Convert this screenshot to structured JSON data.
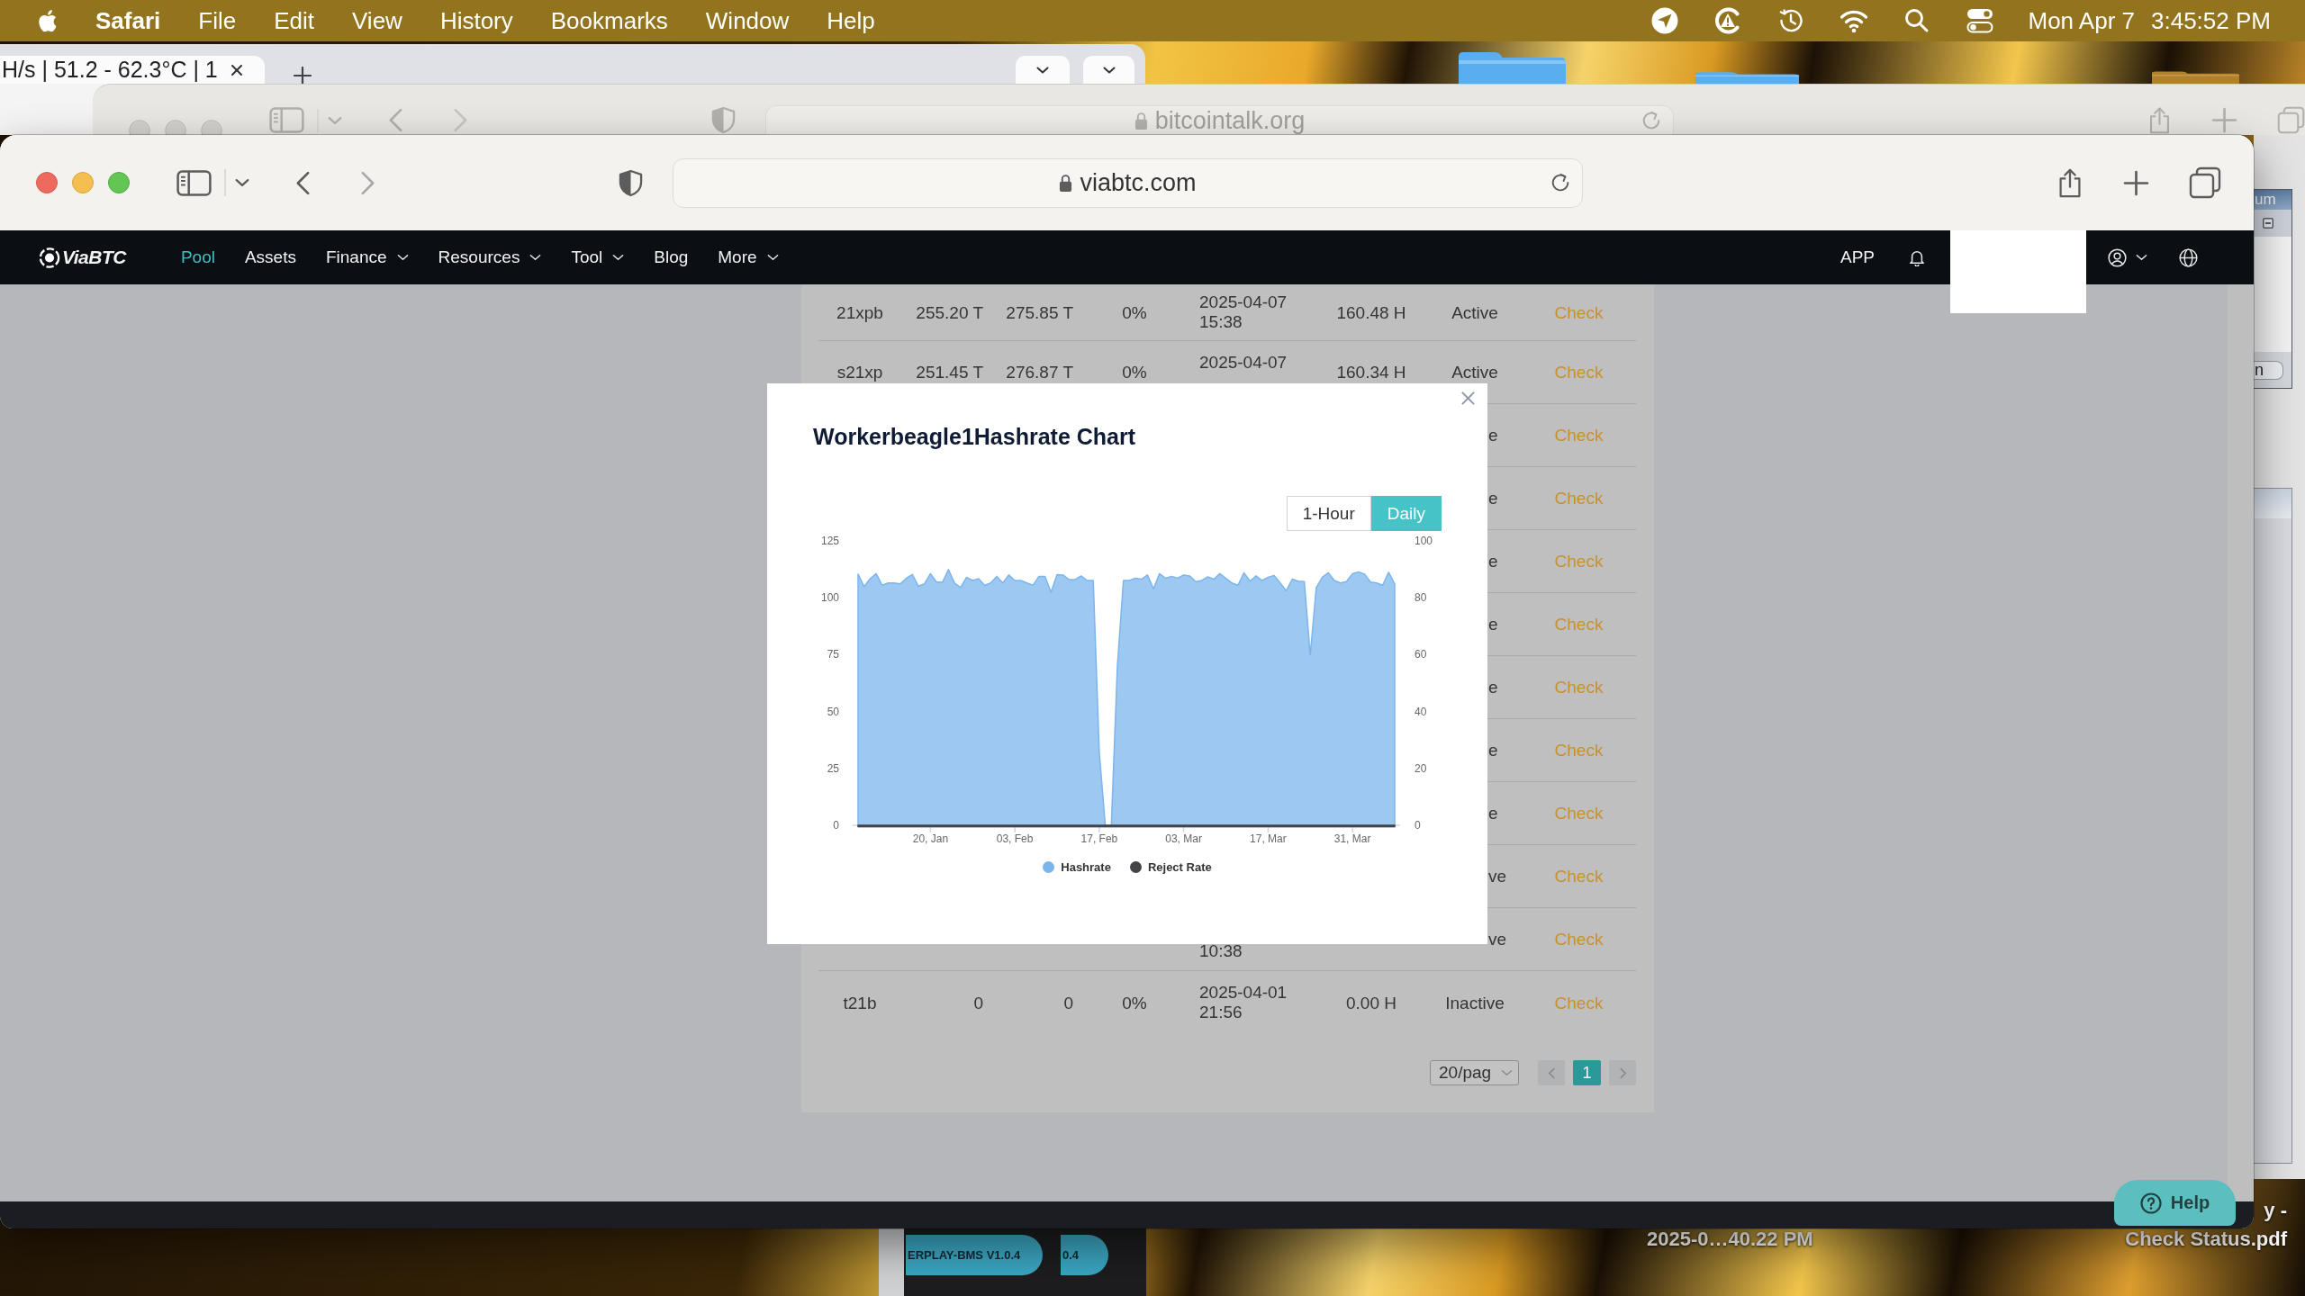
{
  "menu_bar": {
    "app_name": "Safari",
    "menus": [
      "File",
      "Edit",
      "View",
      "History",
      "Bookmarks",
      "Window",
      "Help"
    ],
    "date": "Mon Apr 7",
    "time": "3:45:52 PM"
  },
  "background_tab_window": {
    "tab_title": "H/s | 51.2 - 62.3°C | 1"
  },
  "background_window": {
    "address": "bitcointalk.org"
  },
  "side_window": {
    "header": "um",
    "button_label": "n"
  },
  "browser": {
    "address": "viabtc.com"
  },
  "site_nav": {
    "logo": "ViaBTC",
    "items": [
      {
        "label": "Pool",
        "selected": true,
        "dropdown": false
      },
      {
        "label": "Assets",
        "selected": false,
        "dropdown": false
      },
      {
        "label": "Finance",
        "selected": false,
        "dropdown": true
      },
      {
        "label": "Resources",
        "selected": false,
        "dropdown": true
      },
      {
        "label": "Tool",
        "selected": false,
        "dropdown": true
      },
      {
        "label": "Blog",
        "selected": false,
        "dropdown": false
      },
      {
        "label": "More",
        "selected": false,
        "dropdown": true
      }
    ],
    "app_link": "APP"
  },
  "workers_table": {
    "rows": [
      {
        "kind": "full",
        "column_1": "21xpb",
        "column_2": "255.20 T",
        "column_3": "275.85 T",
        "column_4": "0%",
        "column_5": {
          "line_1": "2025-04-07",
          "line_2": "15:38"
        },
        "column_6": "160.48 H",
        "column_7": "Active",
        "column_8": "Check"
      },
      {
        "kind": "full",
        "column_1": "s21xp",
        "column_2": "251.45 T",
        "column_3": "276.87 T",
        "column_4": "0%",
        "column_5": {
          "line_1": "2025-04-07"
        },
        "column_6": "160.34 H",
        "column_7": "Active",
        "column_8": "Check"
      },
      {
        "kind": "covered",
        "column_7": "e",
        "column_8": "Check"
      },
      {
        "kind": "covered",
        "column_7": "e",
        "column_8": "Check"
      },
      {
        "kind": "covered",
        "column_7": "e",
        "column_8": "Check"
      },
      {
        "kind": "covered",
        "column_7": "e",
        "column_8": "Check"
      },
      {
        "kind": "covered",
        "column_7": "e",
        "column_8": "Check"
      },
      {
        "kind": "covered",
        "column_7": "e",
        "column_8": "Check"
      },
      {
        "kind": "covered",
        "column_7": "e",
        "column_8": "Check"
      },
      {
        "kind": "covered",
        "column_7": "ve",
        "column_8": "Check"
      },
      {
        "kind": "covered",
        "column_5": {
          "line_2": "10:38"
        },
        "column_7": "ve",
        "column_8": "Check"
      },
      {
        "kind": "full",
        "column_1": "t21b",
        "column_2": "0",
        "column_3": "0",
        "column_4": "0%",
        "column_5": {
          "line_1": "2025-04-01",
          "line_2": "21:56"
        },
        "column_6": "0.00 H",
        "column_7": "Inactive",
        "column_8": "Check"
      }
    ],
    "pagination": {
      "page_size": "20/pag",
      "pages": [
        {
          "label": "1",
          "selected": true
        }
      ]
    }
  },
  "chart_modal": {
    "title": "Workerbeagle1Hashrate Chart",
    "ranges": [
      {
        "label": "1-Hour",
        "selected": false
      },
      {
        "label": "Daily",
        "selected": true
      }
    ],
    "chart_data": {
      "type": "area",
      "legend": "bottom",
      "categories": [
        null,
        null,
        null,
        null,
        null,
        null,
        null,
        null,
        null,
        null,
        null,
        null,
        "20, Jan",
        null,
        null,
        null,
        null,
        null,
        null,
        null,
        null,
        null,
        null,
        null,
        null,
        null,
        "03, Feb",
        null,
        null,
        null,
        null,
        null,
        null,
        null,
        null,
        null,
        null,
        null,
        null,
        null,
        "17, Feb",
        null,
        null,
        null,
        null,
        null,
        null,
        null,
        null,
        null,
        null,
        null,
        null,
        null,
        "03, Mar",
        null,
        null,
        null,
        null,
        null,
        null,
        null,
        null,
        null,
        null,
        null,
        null,
        null,
        "17, Mar",
        null,
        null,
        null,
        null,
        null,
        null,
        null,
        null,
        null,
        null,
        null,
        null,
        null,
        "31, Mar",
        null,
        null,
        null,
        null,
        null,
        null,
        null
      ],
      "series": [
        {
          "name": "Hashrate",
          "color": "#7cb5ec",
          "values": [
            110.4,
            104.9,
            108.4,
            110.6,
            105.5,
            106.5,
            106.5,
            106.1,
            108.6,
            110.2,
            105.1,
            106.1,
            110.6,
            106.9,
            106.9,
            112.4,
            106.5,
            104.5,
            109.0,
            107.6,
            108.4,
            105.5,
            106.5,
            109.4,
            106.5,
            110.0,
            107.6,
            107.6,
            106.5,
            105.5,
            109.4,
            109.4,
            102.4,
            110.2,
            110.0,
            108.0,
            108.0,
            109.6,
            107.6,
            107.6,
            32,
            0,
            0,
            70,
            107.6,
            107.6,
            108.6,
            108.2,
            110.0,
            103.9,
            110.6,
            108.6,
            109.4,
            108.6,
            110.0,
            109.6,
            107.1,
            107.6,
            109.2,
            108.2,
            110.6,
            108.6,
            106.5,
            105.5,
            111.0,
            107.3,
            109.6,
            107.6,
            109.0,
            109.8,
            106.5,
            103.1,
            108.2,
            107.3,
            107.1,
            74.9,
            104.5,
            109.0,
            111.0,
            107.6,
            106.5,
            107.1,
            110.6,
            111.4,
            110.4,
            106.9,
            106.5,
            105.5,
            111.2,
            106.1
          ]
        },
        {
          "name": "Reject Rate",
          "color": "#434348",
          "values": [
            0,
            0,
            0,
            0,
            0,
            0,
            0,
            0,
            0,
            0,
            0,
            0,
            0,
            0,
            0,
            0,
            0,
            0,
            0,
            0,
            0,
            0,
            0,
            0,
            0,
            0,
            0,
            0,
            0,
            0,
            0,
            0,
            0,
            0,
            0,
            0,
            0,
            0,
            0,
            0,
            0,
            0,
            0,
            0,
            0,
            0,
            0,
            0,
            0,
            0,
            0,
            0,
            0,
            0,
            0,
            0,
            0,
            0,
            0,
            0,
            0,
            0,
            0,
            0,
            0,
            0,
            0,
            0,
            0,
            0,
            0,
            0,
            0,
            0,
            0,
            0,
            0,
            0,
            0,
            0,
            0,
            0,
            0,
            0,
            0,
            0,
            0,
            0,
            0,
            0
          ]
        }
      ],
      "ylim": [
        0,
        125
      ],
      "yticks": [
        0,
        25,
        50,
        75,
        100,
        125
      ],
      "y2lim": [
        0,
        100
      ],
      "y2ticks": [
        0,
        20,
        40,
        60,
        80,
        100
      ]
    }
  },
  "help_button": {
    "label": "Help"
  },
  "desktop": {
    "app_tabs": [
      "ERPLAY-BMS V1.0.4",
      "0.4"
    ],
    "file_labels": [
      {
        "lines": [
          "2025-0…40.22 PM"
        ]
      },
      {
        "lines": [
          "y -",
          "Check Status.pdf"
        ]
      }
    ]
  }
}
